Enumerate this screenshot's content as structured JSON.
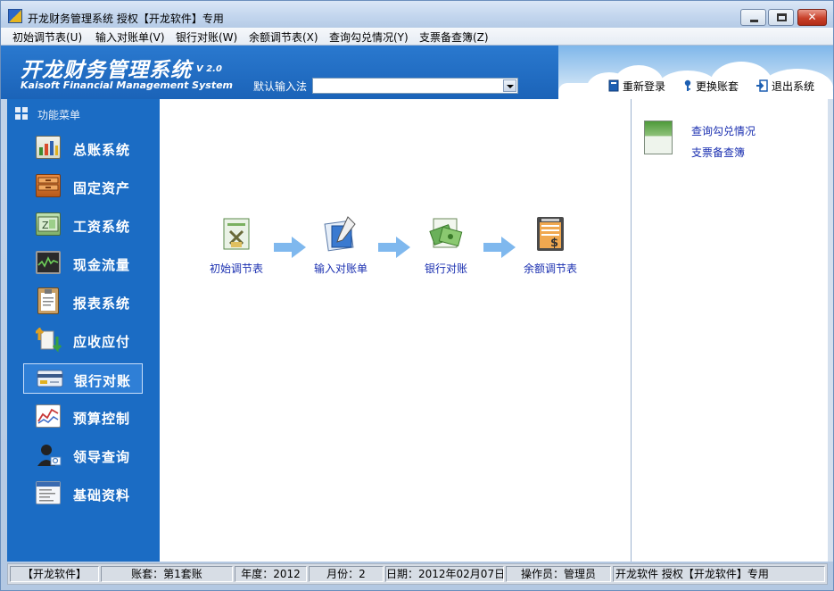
{
  "window": {
    "title": "开龙财务管理系统 授权【开龙软件】专用"
  },
  "menubar": {
    "items": [
      "初始调节表(U)",
      "输入对账单(V)",
      "银行对账(W)",
      "余额调节表(X)",
      "查询勾兑情况(Y)",
      "支票备查簿(Z)"
    ]
  },
  "header": {
    "logo_cn": "开龙财务管理系统",
    "logo_version": "V 2.0",
    "logo_en": "Kaisoft Financial Management System",
    "ime_label": "默认输入法",
    "ime_value": "",
    "buttons": {
      "relogin": "重新登录",
      "switch_account": "更换账套",
      "exit": "退出系统"
    }
  },
  "sidebar": {
    "title": "功能菜单",
    "items": [
      {
        "label": "总账系统",
        "icon": "ledger-icon",
        "active": false,
        "color": "#5a8f4a"
      },
      {
        "label": "固定资产",
        "icon": "drawer-icon",
        "active": false,
        "color": "#c46a2a"
      },
      {
        "label": "工资系统",
        "icon": "wage-icon",
        "active": false,
        "color": "#6aa05a"
      },
      {
        "label": "现金流量",
        "icon": "monitor-icon",
        "active": false,
        "color": "#3a4a3a"
      },
      {
        "label": "报表系统",
        "icon": "clipboard-icon",
        "active": false,
        "color": "#d8b070"
      },
      {
        "label": "应收应付",
        "icon": "transfer-icon",
        "active": false,
        "color": "#e0a020"
      },
      {
        "label": "银行对账",
        "icon": "bank-card-icon",
        "active": true,
        "color": "#4a7fc0"
      },
      {
        "label": "预算控制",
        "icon": "chart-icon",
        "active": false,
        "color": "#c83a3a"
      },
      {
        "label": "领导查询",
        "icon": "leader-icon",
        "active": false,
        "color": "#222222"
      },
      {
        "label": "基础资料",
        "icon": "document-icon",
        "active": false,
        "color": "#9aaac0"
      }
    ]
  },
  "flow": {
    "steps": [
      {
        "label": "初始调节表",
        "icon": "initial-table-icon"
      },
      {
        "label": "输入对账单",
        "icon": "input-statement-icon"
      },
      {
        "label": "银行对账",
        "icon": "bank-reconcile-icon"
      },
      {
        "label": "余额调节表",
        "icon": "balance-table-icon"
      }
    ]
  },
  "right_panel": {
    "links": [
      "查询勾兑情况",
      "支票备查簿"
    ]
  },
  "statusbar": {
    "company": "【开龙软件】",
    "account_set": "账套：第1套账",
    "year": "年度：2012",
    "month": "月份：2",
    "date": "日期：2012年02月07日",
    "operator": "操作员：管理员",
    "license": "开龙软件 授权【开龙软件】专用"
  },
  "colors": {
    "banner_blue": "#1b63b8",
    "sidebar_blue": "#1b6cc4",
    "link_blue": "#1a2fb0",
    "close_red": "#c8412a"
  }
}
